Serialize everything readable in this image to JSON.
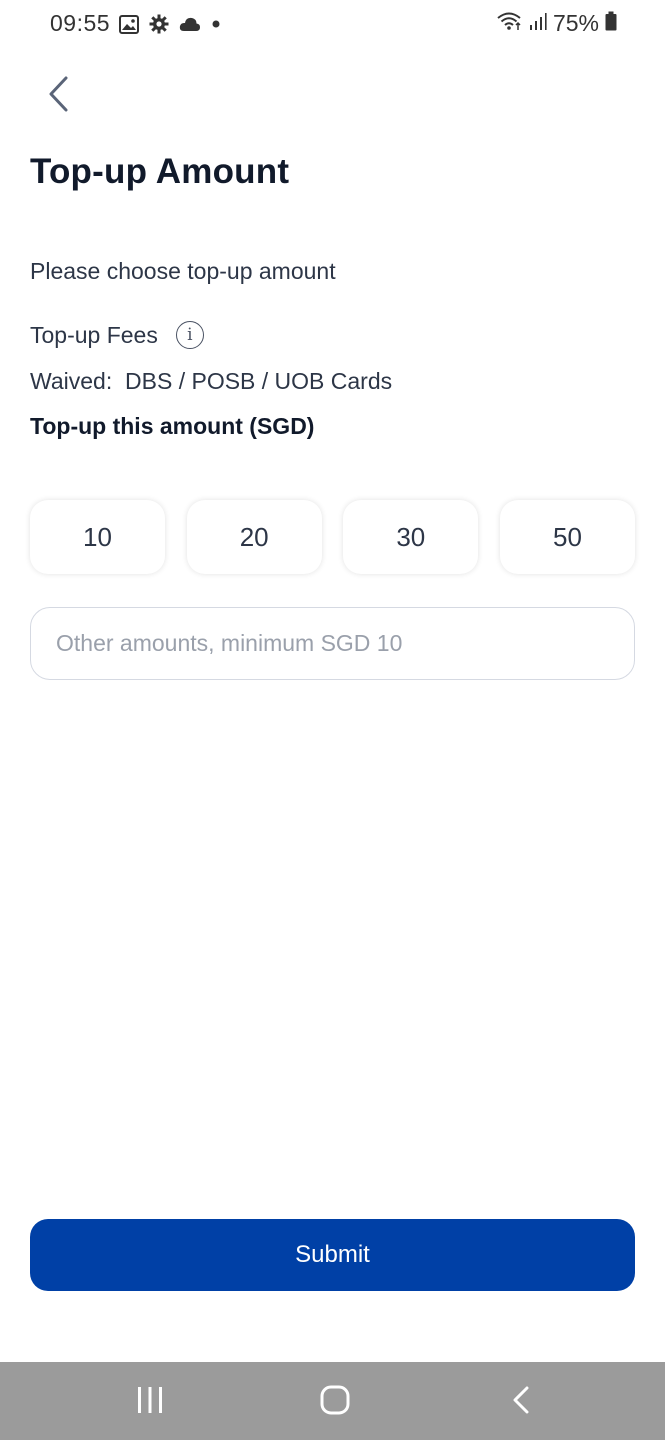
{
  "status_bar": {
    "time": "09:55",
    "battery": "75%",
    "left_icons": [
      "image-icon",
      "gear-icon",
      "cloud-icon",
      "dot-icon"
    ],
    "right_icons": [
      "wifi-icon",
      "signal-icon",
      "battery-icon"
    ]
  },
  "header": {
    "back_icon": "chevron-left-icon",
    "title": "Top-up Amount"
  },
  "content": {
    "instruction": "Please choose top-up amount",
    "fees_label": "Top-up Fees",
    "fees_info_icon": "info-icon",
    "info_glyph": "i",
    "waived_text": "Waived:  DBS / POSB / UOB Cards",
    "amount_label": "Top-up this amount (SGD)",
    "amount_options": [
      "10",
      "20",
      "30",
      "50"
    ],
    "other_amount_placeholder": "Other amounts, minimum SGD 10",
    "other_amount_value": ""
  },
  "actions": {
    "submit_label": "Submit"
  },
  "nav_bar": {
    "buttons": [
      "recent-apps-icon",
      "home-icon",
      "back-icon"
    ]
  },
  "colors": {
    "primary": "#0040a6",
    "nav_bar": "#9b9b9b",
    "title_text": "#111a2b",
    "body_text": "#2d3647",
    "placeholder": "#9aa0ab"
  }
}
